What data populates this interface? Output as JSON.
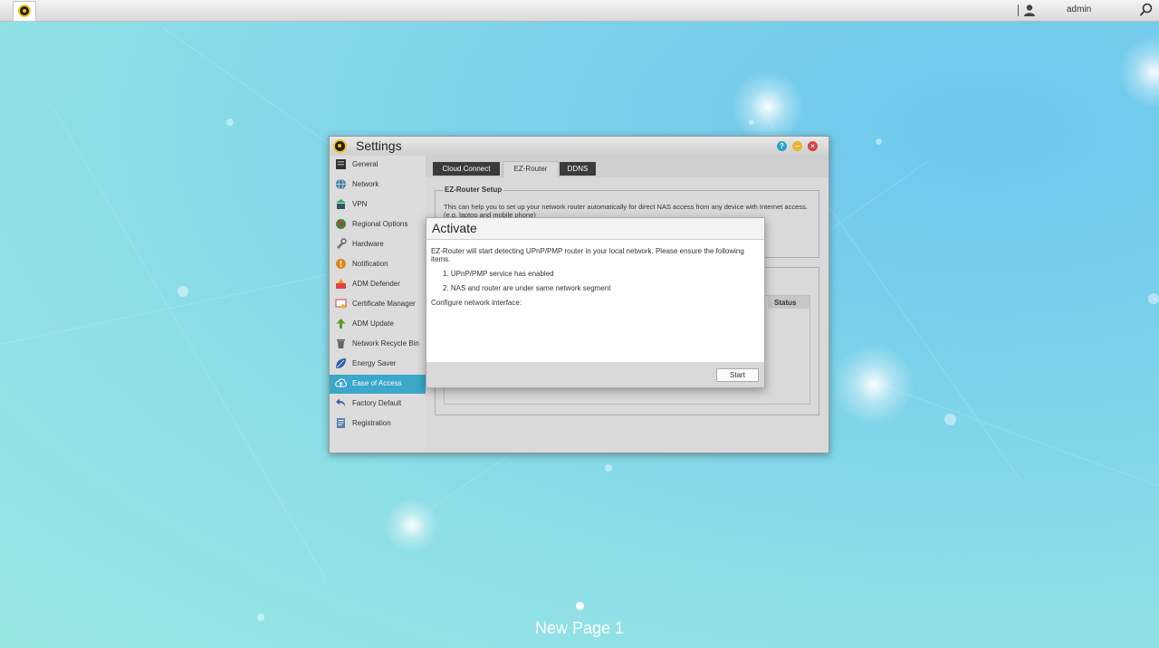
{
  "topbar": {
    "username": "admin"
  },
  "settings": {
    "title": "Settings",
    "sidebar": [
      {
        "label": "General",
        "icon": "general-icon"
      },
      {
        "label": "Network",
        "icon": "network-icon"
      },
      {
        "label": "VPN",
        "icon": "vpn-icon"
      },
      {
        "label": "Regional Options",
        "icon": "regional-options-icon"
      },
      {
        "label": "Hardware",
        "icon": "hardware-icon"
      },
      {
        "label": "Notification",
        "icon": "notification-icon"
      },
      {
        "label": "ADM Defender",
        "icon": "adm-defender-icon"
      },
      {
        "label": "Certificate Manager",
        "icon": "certificate-manager-icon"
      },
      {
        "label": "ADM Update",
        "icon": "adm-update-icon"
      },
      {
        "label": "Network Recycle Bin",
        "icon": "recycle-bin-icon"
      },
      {
        "label": "Energy Saver",
        "icon": "energy-saver-icon"
      },
      {
        "label": "Ease of Access",
        "icon": "ease-of-access-icon"
      },
      {
        "label": "Factory Default",
        "icon": "factory-default-icon"
      },
      {
        "label": "Registration",
        "icon": "registration-icon"
      }
    ],
    "active_item": "Ease of Access",
    "tabs": [
      "Cloud Connect",
      "EZ-Router",
      "DDNS"
    ],
    "active_tab": "EZ-Router",
    "ez_router_setup": {
      "legend": "EZ-Router Setup",
      "description": "This can help you to set up your network router automatically for direct NAS access from any device with Internet access. (e.g. laptop and mobile phone)"
    },
    "table": {
      "status_header": "Status"
    }
  },
  "modal": {
    "title": "Activate",
    "intro": "EZ-Router will start detecting UPnP/PMP router in your local network. Please ensure the following items.",
    "items": [
      "1. UPnP/PMP service has enabled",
      "2. NAS and router are under same network segment"
    ],
    "configure_label": "Configure network interface:",
    "start_label": "Start"
  },
  "desktop": {
    "page_label": "New Page 1"
  },
  "colors": {
    "accent": "#3aa7cb",
    "close": "#d94040",
    "minimize": "#e8b62a",
    "help": "#2ea2c6"
  }
}
